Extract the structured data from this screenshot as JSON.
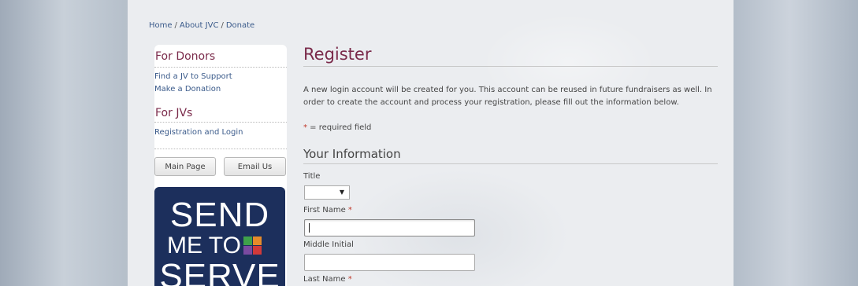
{
  "breadcrumb": {
    "items": [
      "Home",
      "About JVC",
      "Donate"
    ],
    "separator": "/"
  },
  "sidebar": {
    "donors_heading": "For Donors",
    "donors_links": [
      "Find a JV to Support",
      "Make a Donation"
    ],
    "jvs_heading": "For JVs",
    "jvs_links": [
      "Registration and Login"
    ],
    "buttons": {
      "main_page": "Main Page",
      "email_us": "Email Us"
    },
    "banner": {
      "line1": "SEND",
      "line2": "ME TO",
      "line3": "SERVE"
    }
  },
  "main": {
    "title": "Register",
    "intro": "A new login account will be created for you. This account can be reused in future fundraisers as well. In order to create the account and process your registration, please fill out the information below.",
    "required_star": "*",
    "required_note": " = required field",
    "section_title": "Your Information",
    "fields": {
      "title_label": "Title",
      "title_value": "",
      "first_name_label": "First Name",
      "first_name_value": "",
      "middle_initial_label": "Middle Initial",
      "middle_initial_value": "",
      "last_name_label": "Last Name"
    }
  },
  "colors": {
    "heading": "#7a2a4a",
    "link": "#3a5a8a",
    "banner": "#1c2f5c",
    "required": "#c0392b"
  }
}
